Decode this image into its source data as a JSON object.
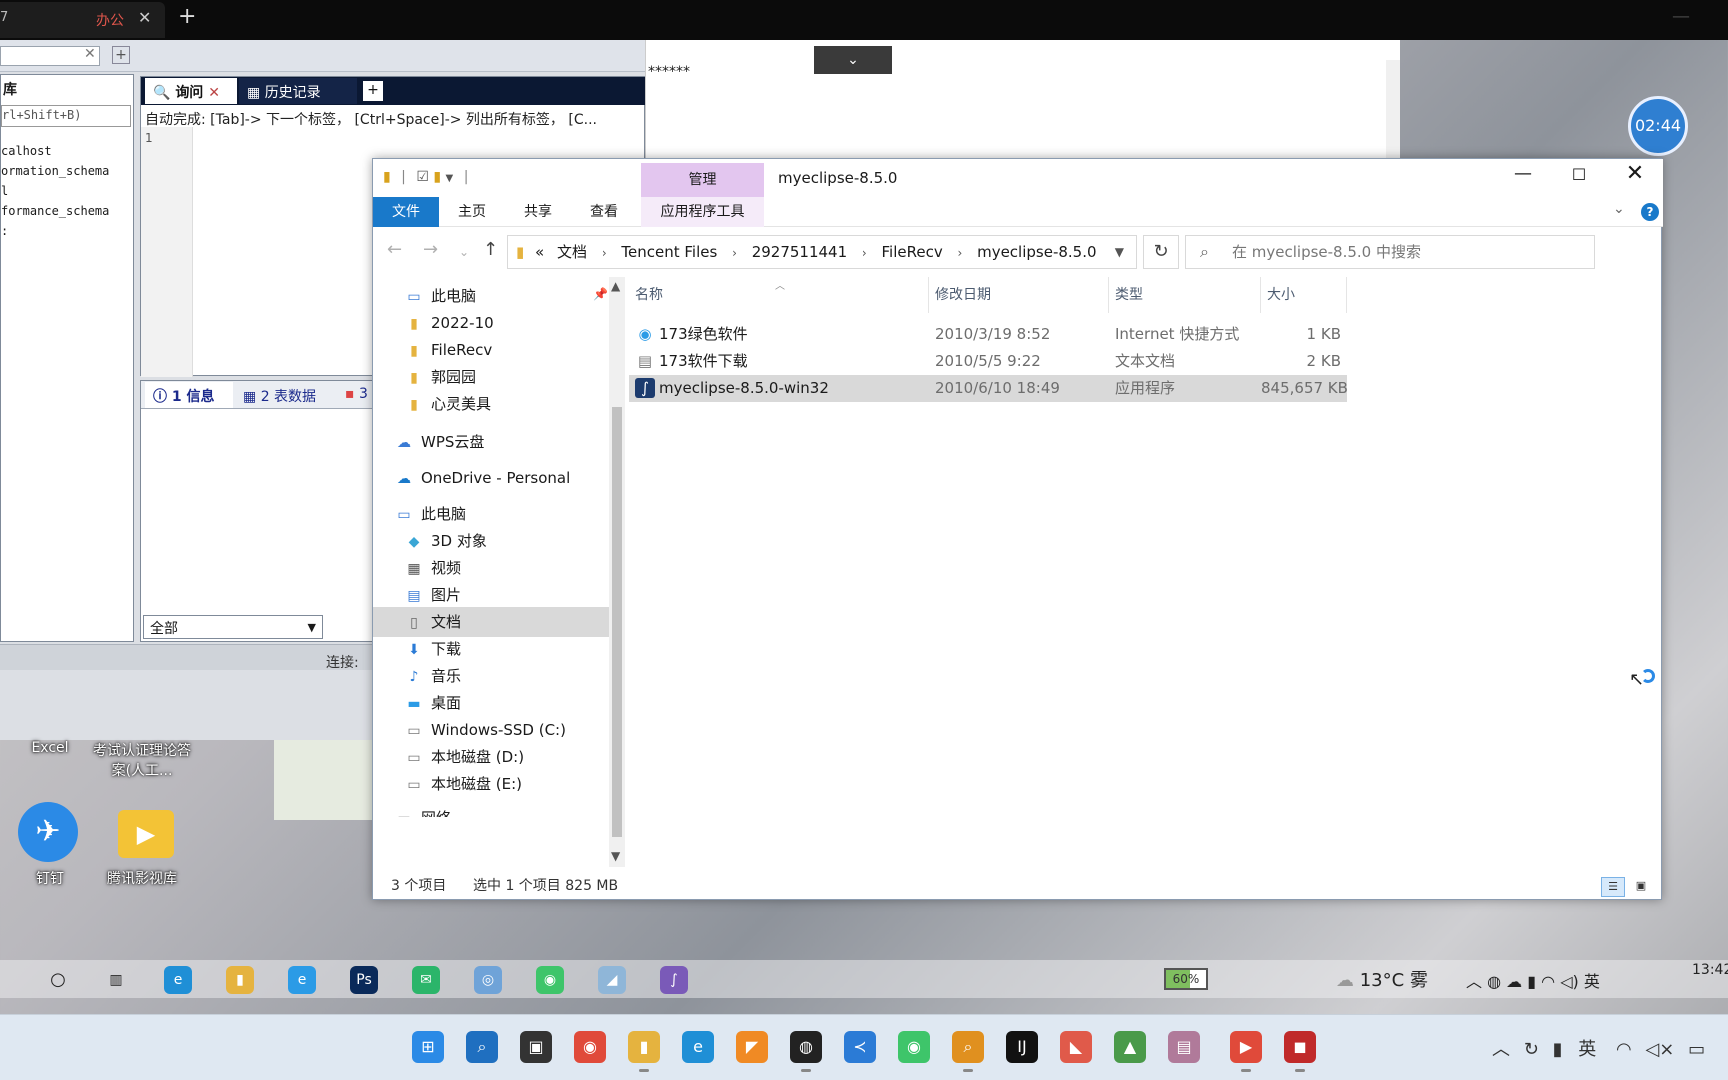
{
  "browser": {
    "tab_prefix": "7",
    "tab_label": "办公",
    "close": "✕",
    "add": "+",
    "minimize": "—"
  },
  "sql_tool": {
    "toolbar_close": "✕",
    "toolbar_add": "+",
    "db_panel_label": "库",
    "shortcut_hint": "rl+Shift+B)",
    "databases": [
      "calhost",
      "ormation_schema",
      "l",
      "formance_schema",
      ":"
    ],
    "query_tab": "询问",
    "history_tab": "历史记录",
    "add_tab": "+",
    "autocomplete_hint": "自动完成: [Tab]-> 下一个标签， [Ctrl+Space]-> 列出所有标签， [C...",
    "line_number": "1",
    "info_tab": "1 信息",
    "table_data_tab": "2 表数据",
    "third_tab": "3",
    "filter_select": "全部",
    "connection_label": "连接:"
  },
  "editor": {
    "text": "******",
    "dropdown": "⌄"
  },
  "desktop": {
    "icons": [
      {
        "label": "Excel"
      },
      {
        "label": "考试认证理论答案(人工..."
      },
      {
        "label": "钉钉"
      },
      {
        "label": "腾讯影视库"
      }
    ],
    "timer": "02:44"
  },
  "explorer": {
    "title": "myeclipse-8.5.0",
    "manage_tab": "管理",
    "ribbon_tabs": {
      "file": "文件",
      "home": "主页",
      "share": "共享",
      "view": "查看",
      "app_tools": "应用程序工具"
    },
    "window_controls": {
      "minimize": "—",
      "maximize": "☐",
      "close": "✕"
    },
    "help": "?",
    "address": {
      "overflow": "«",
      "segments": [
        "文档",
        "Tencent Files",
        "2927511441",
        "FileRecv",
        "myeclipse-8.5.0"
      ]
    },
    "search_placeholder": "在 myeclipse-8.5.0 中搜索",
    "nav_items": [
      {
        "label": "此电脑",
        "icon": "computer-icon"
      },
      {
        "label": "2022-10",
        "icon": "folder-icon"
      },
      {
        "label": "FileRecv",
        "icon": "folder-icon"
      },
      {
        "label": "郭园园",
        "icon": "folder-icon"
      },
      {
        "label": "心灵美具",
        "icon": "folder-icon"
      },
      {
        "label": "WPS云盘",
        "icon": "cloud-icon"
      },
      {
        "label": "OneDrive - Personal",
        "icon": "onedrive-icon"
      },
      {
        "label": "此电脑",
        "icon": "computer-icon"
      },
      {
        "label": "3D 对象",
        "icon": "cube-icon"
      },
      {
        "label": "视频",
        "icon": "film-icon"
      },
      {
        "label": "图片",
        "icon": "picture-icon"
      },
      {
        "label": "文档",
        "icon": "document-icon",
        "selected": true
      },
      {
        "label": "下载",
        "icon": "download-icon"
      },
      {
        "label": "音乐",
        "icon": "music-icon"
      },
      {
        "label": "桌面",
        "icon": "desktop-icon"
      },
      {
        "label": "Windows-SSD (C:)",
        "icon": "drive-icon"
      },
      {
        "label": "本地磁盘 (D:)",
        "icon": "drive-icon"
      },
      {
        "label": "本地磁盘 (E:)",
        "icon": "drive-icon"
      },
      {
        "label": "网络",
        "icon": "network-icon"
      }
    ],
    "columns": {
      "name": "名称",
      "date": "修改日期",
      "type": "类型",
      "size": "大小"
    },
    "files": [
      {
        "name": "173绿色软件",
        "date": "2010/3/19 8:52",
        "type": "Internet 快捷方式",
        "size": "1 KB",
        "icon": "internet-shortcut-icon"
      },
      {
        "name": "173软件下载",
        "date": "2010/5/5 9:22",
        "type": "文本文档",
        "size": "2 KB",
        "icon": "text-file-icon"
      },
      {
        "name": "myeclipse-8.5.0-win32",
        "date": "2010/6/10 18:49",
        "type": "应用程序",
        "size": "845,657 KB",
        "icon": "application-icon",
        "selected": true
      }
    ],
    "status": {
      "count": "3 个项目",
      "selection": "选中 1 个项目  825 MB"
    }
  },
  "inner_taskbar": {
    "battery": "60%",
    "temperature": "13°C",
    "weather_text": "雾",
    "ime": "英",
    "clock": "13:42"
  },
  "taskbar": {
    "ime": "英"
  },
  "colors": {
    "accent": "#1979ca",
    "manage_tab": "#e3c6ef",
    "selection": "#d9d9d9"
  }
}
